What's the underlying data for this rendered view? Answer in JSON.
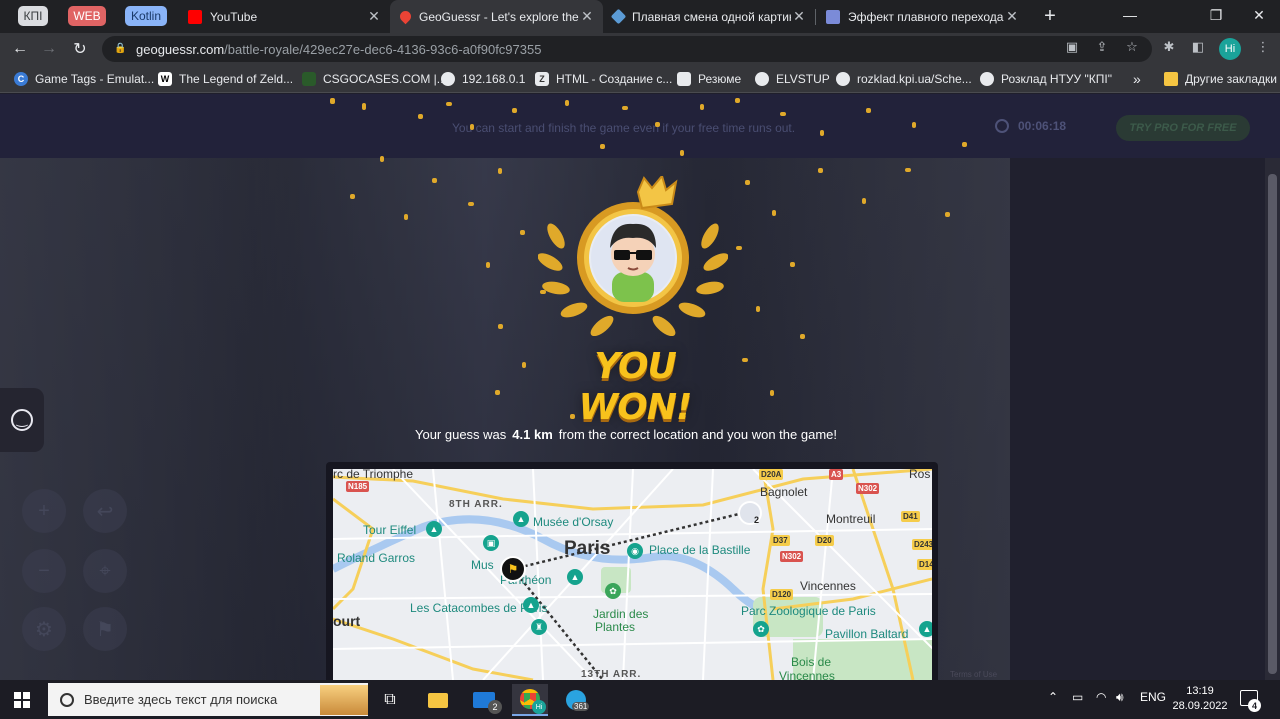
{
  "browser": {
    "pinned": [
      "КПІ",
      "WEB",
      "Kotlin"
    ],
    "tabs": [
      {
        "title": "YouTube",
        "favicon_color": "#ff0000"
      },
      {
        "title": "GeoGuessr - Let's explore the w",
        "favicon_color": "#ea4335"
      },
      {
        "title": "Плавная смена одной картинки",
        "favicon_color": "#5b9bd5"
      },
      {
        "title": "Эффект плавного перехода на CSS",
        "favicon_color": "#7b8bd8"
      }
    ],
    "new_tab": "+",
    "controls": {
      "minimize": "—",
      "maximize": "❐",
      "close": "✕"
    },
    "url_host": "geoguessr.com",
    "url_path": "/battle-royale/429ec27e-dec6-4136-93c6-a0f90fc97355",
    "profile_initials": "Hi",
    "bookmarks": [
      {
        "label": "Game Tags - Emulat...",
        "icon_color": "#3a7bd5"
      },
      {
        "label": "The Legend of Zeld...",
        "icon_color": "#ffffff"
      },
      {
        "label": "CSGOCASES.COM |...",
        "icon_color": "#2a5a2a"
      },
      {
        "label": "192.168.0.1",
        "icon_color": "#e8eaed"
      },
      {
        "label": "HTML - Создание с...",
        "icon_color": "#e8eaed"
      },
      {
        "label": "Резюме",
        "icon_color": "#e8eaed"
      },
      {
        "label": "ELVSTUP",
        "icon_color": "#e8eaed"
      },
      {
        "label": "rozklad.kpi.ua/Sche...",
        "icon_color": "#e8eaed"
      },
      {
        "label": "Розклад НТУУ \"КПІ\"",
        "icon_color": "#e8eaed"
      }
    ],
    "more_bookmarks": "»",
    "other_bookmarks": "Другие закладки"
  },
  "game": {
    "hint": "You can start and finish the game even if your free time runs out.",
    "timer": "00:06:18",
    "pro_button": "TRY PRO FOR FREE",
    "title": "YOU WON!",
    "result_prefix": "Your guess was",
    "distance": "4.1 km",
    "result_suffix": "from the correct location and you won the game!",
    "accent": "#f8c21c"
  },
  "map": {
    "labels": {
      "arc": "rc de Triomphe",
      "arr8": "8TH ARR.",
      "orsay": "Musée d'Orsay",
      "eiffel": "Tour Eiffel",
      "paris": "Paris",
      "bastille": "Place de la Bastille",
      "garros": "Roland Garros",
      "musee": "Mus",
      "pantheon": "Panthéon",
      "catacombes": "Les Catacombes de Paris",
      "jardin1": "Jardin des",
      "jardin2": "Plantes",
      "court": "ourt",
      "bagnolet": "Bagnolet",
      "montreuil": "Montreuil",
      "vincennes": "Vincennes",
      "zoo": "Parc Zoologique de Paris",
      "baltard": "Pavillon Baltard",
      "bois": "Bois de",
      "bois2": "Vincennes",
      "arr13": "13TH ARR.",
      "ros": "Ros",
      "player_count": "2"
    },
    "roads": [
      "N185",
      "D20A",
      "A3",
      "N302",
      "D41",
      "D37",
      "D20",
      "N302",
      "D243",
      "D120",
      "D14"
    ],
    "terms": "Terms of Use"
  },
  "taskbar": {
    "search_placeholder": "Введите здесь текст для поиска",
    "mail_badge": "2",
    "telegram_badge": "361",
    "chrome_badge": "Hi",
    "language": "ENG",
    "time": "13:19",
    "date": "28.09.2022",
    "notifications": "4"
  }
}
